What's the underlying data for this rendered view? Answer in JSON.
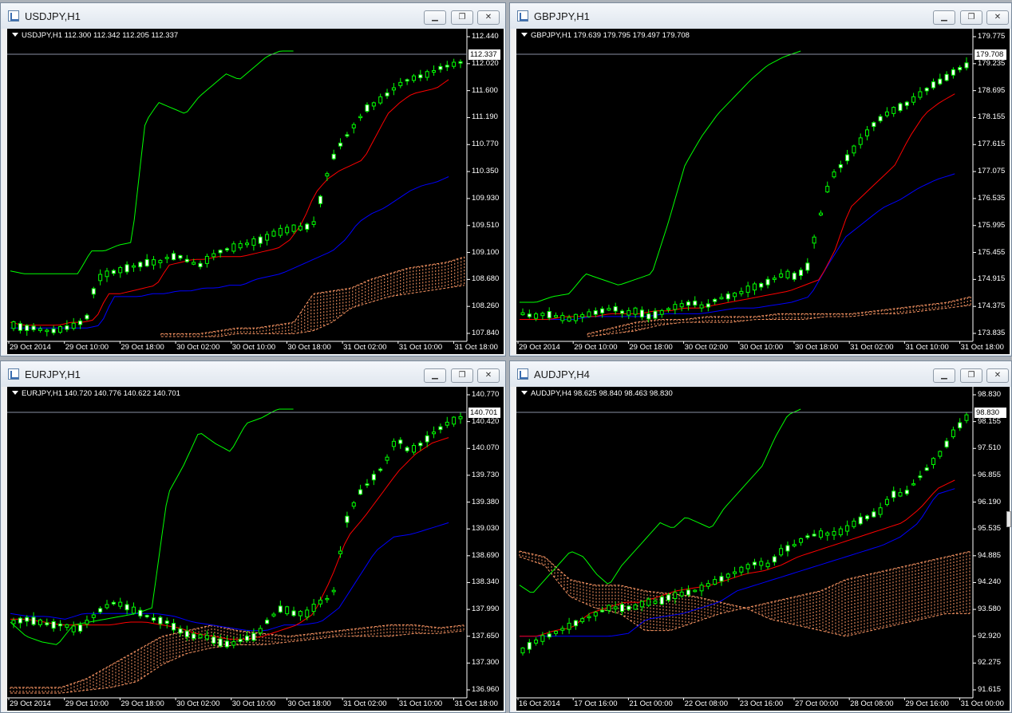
{
  "windows": [
    {
      "id": "usdjpy",
      "title": "USDJPY,H1",
      "info_label": "USDJPY,H1  112.300 112.342 112.205 112.337",
      "current_price": "112.337",
      "y_ticks": [
        "112.440",
        "112.020",
        "111.600",
        "111.190",
        "110.770",
        "110.350",
        "109.930",
        "109.510",
        "109.100",
        "108.680",
        "108.260",
        "107.840"
      ],
      "x_ticks": [
        "29 Oct 2014",
        "29 Oct 10:00",
        "29 Oct 18:00",
        "30 Oct 02:00",
        "30 Oct 10:00",
        "30 Oct 18:00",
        "31 Oct 02:00",
        "31 Oct 10:00",
        "31 Oct 18:00"
      ],
      "y_range": [
        107.84,
        112.44
      ]
    },
    {
      "id": "gbpjpy",
      "title": "GBPJPY,H1",
      "info_label": "GBPJPY,H1  179.639 179.795 179.497 179.708",
      "current_price": "179.708",
      "y_ticks": [
        "179.775",
        "179.235",
        "178.695",
        "178.155",
        "177.615",
        "177.075",
        "176.535",
        "175.995",
        "175.455",
        "174.915",
        "174.375",
        "173.835"
      ],
      "x_ticks": [
        "29 Oct 2014",
        "29 Oct 10:00",
        "29 Oct 18:00",
        "30 Oct 02:00",
        "30 Oct 10:00",
        "30 Oct 18:00",
        "31 Oct 02:00",
        "31 Oct 10:00",
        "31 Oct 18:00"
      ],
      "y_range": [
        173.835,
        179.775
      ]
    },
    {
      "id": "eurjpy",
      "title": "EURJPY,H1",
      "info_label": "EURJPY,H1  140.720 140.776 140.622 140.701",
      "current_price": "140.701",
      "y_ticks": [
        "140.770",
        "140.420",
        "140.070",
        "139.730",
        "139.380",
        "139.030",
        "138.690",
        "138.340",
        "137.990",
        "137.650",
        "137.300",
        "136.960"
      ],
      "x_ticks": [
        "29 Oct 2014",
        "29 Oct 10:00",
        "29 Oct 18:00",
        "30 Oct 02:00",
        "30 Oct 10:00",
        "30 Oct 18:00",
        "31 Oct 02:00",
        "31 Oct 10:00",
        "31 Oct 18:00"
      ],
      "y_range": [
        136.96,
        140.77
      ]
    },
    {
      "id": "audjpy",
      "title": "AUDJPY,H4",
      "info_label": "AUDJPY,H4  98.625 98.840 98.463 98.830",
      "current_price": "98.830",
      "y_ticks": [
        "98.830",
        "98.155",
        "97.510",
        "96.855",
        "96.190",
        "95.535",
        "94.885",
        "94.240",
        "93.580",
        "92.920",
        "92.275",
        "91.615"
      ],
      "x_ticks": [
        "16 Oct 2014",
        "17 Oct 16:00",
        "21 Oct 00:00",
        "22 Oct 08:00",
        "23 Oct 16:00",
        "27 Oct 00:00",
        "28 Oct 08:00",
        "29 Oct 16:00",
        "31 Oct 00:00"
      ],
      "y_range": [
        91.615,
        98.83
      ]
    }
  ],
  "colors": {
    "candle_up": "#00ff00",
    "candle_down_body": "#ffffff",
    "tenkan": "#ff0000",
    "kijun": "#0000ff",
    "chikou": "#00ff00",
    "kumo": "#ff9966",
    "background": "#000000"
  },
  "icons": {
    "minimize": "minimize-icon",
    "restore": "restore-icon",
    "close": "close-icon"
  },
  "button_glyphs": {
    "minimize": "▁",
    "restore": "❐",
    "close": "✕"
  }
}
